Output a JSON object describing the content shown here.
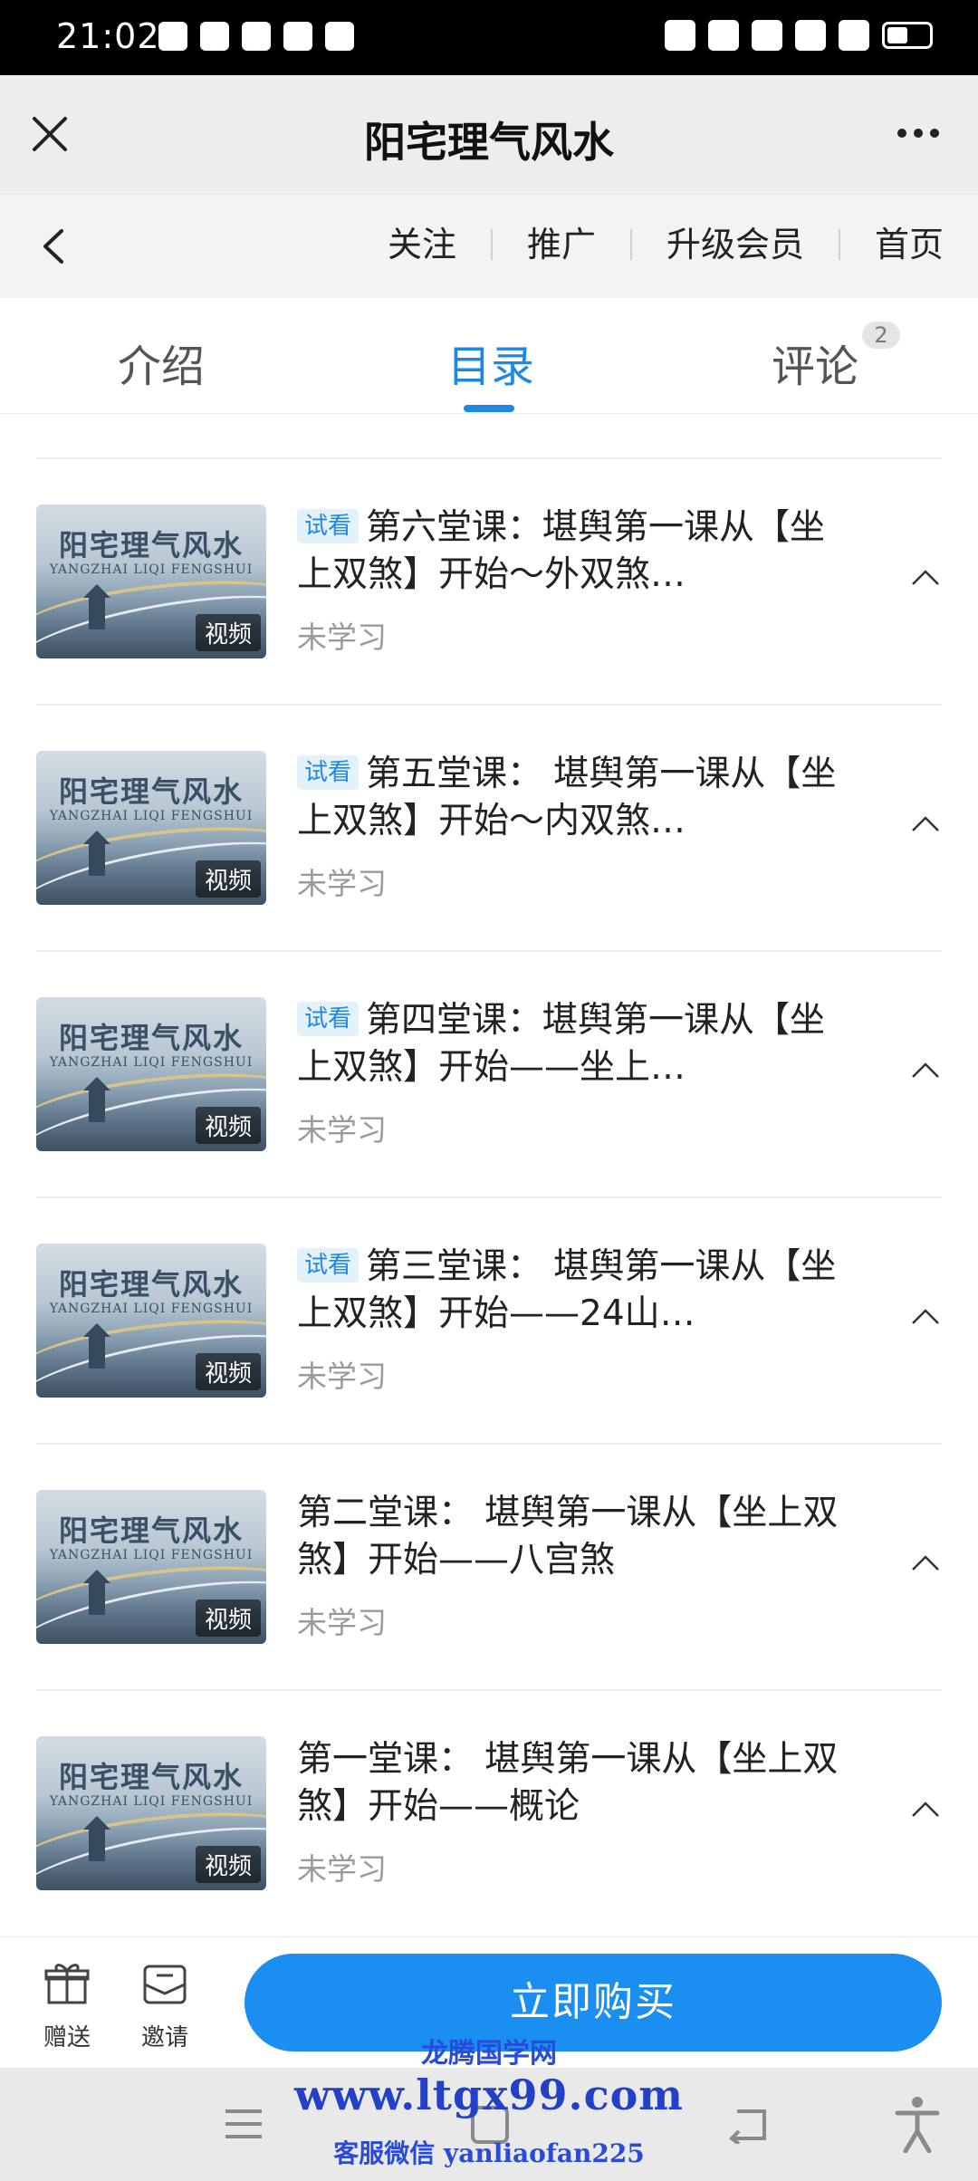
{
  "status_bar": {
    "time": "21:02"
  },
  "header": {
    "title": "阳宅理气风水"
  },
  "nav": {
    "links": [
      "关注",
      "推广",
      "升级会员",
      "首页"
    ]
  },
  "tabs": [
    {
      "label": "介绍",
      "active": false
    },
    {
      "label": "目录",
      "active": true
    },
    {
      "label": "评论",
      "active": false,
      "badge": "2"
    }
  ],
  "thumbnail": {
    "title": "阳宅理气风水",
    "subtitle": "YANGZHAI LIQI FENGSHUI",
    "tag": "视频"
  },
  "lessons": [
    {
      "trial": "试看",
      "title": "第六堂课：堪舆第一课从【坐上双煞】开始～外双煞…",
      "status": "未学习"
    },
    {
      "trial": "试看",
      "title": "第五堂课： 堪舆第一课从【坐上双煞】开始～内双煞…",
      "status": "未学习"
    },
    {
      "trial": "试看",
      "title": "第四堂课：堪舆第一课从【坐上双煞】开始——坐上…",
      "status": "未学习"
    },
    {
      "trial": "试看",
      "title": "第三堂课： 堪舆第一课从【坐上双煞】开始——24山…",
      "status": "未学习"
    },
    {
      "trial": "",
      "title": "第二堂课： 堪舆第一课从【坐上双煞】开始——八宫煞",
      "status": "未学习"
    },
    {
      "trial": "",
      "title": "第一堂课： 堪舆第一课从【坐上双煞】开始——概论",
      "status": "未学习"
    }
  ],
  "bottom": {
    "gift": "赠送",
    "invite": "邀请",
    "buy": "立即购买"
  },
  "watermark": {
    "site": "龙腾国学网",
    "url": "www.ltgx99.com",
    "contact": "客服微信 yanliaofan225"
  },
  "colors": {
    "accent": "#1e88e5",
    "button": "#1a8ef1"
  }
}
